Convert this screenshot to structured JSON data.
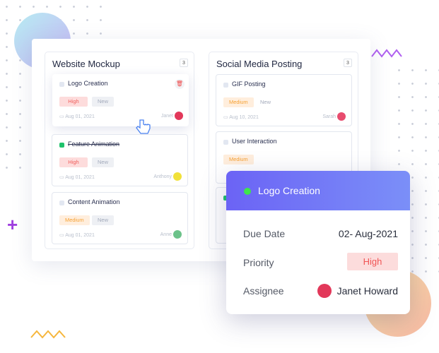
{
  "board": {
    "columns": [
      {
        "title": "Website Mockup",
        "count": "3",
        "cards": [
          {
            "title": "Logo Creation",
            "done": false,
            "priority": "High",
            "status": "New",
            "date": "Aug 01, 2021",
            "assignee": "Janet"
          },
          {
            "title": "Feature Animation",
            "done": true,
            "priority": "High",
            "status": "New",
            "date": "Aug 01, 2021",
            "assignee": "Anthony"
          },
          {
            "title": "Content Animation",
            "done": false,
            "priority": "Medium",
            "status": "New",
            "date": "Aug 01, 2021",
            "assignee": "Anne"
          }
        ]
      },
      {
        "title": "Social Media Posting",
        "count": "3",
        "cards": [
          {
            "title": "GIF Posting",
            "done": false,
            "priority": "Medium",
            "status": "New",
            "date": "Aug 10, 2021",
            "assignee": "Sarah"
          },
          {
            "title": "User Interaction",
            "done": false,
            "priority": "Medium"
          }
        ]
      }
    ]
  },
  "popup": {
    "title": "Logo Creation",
    "status_color": "#3ee64a",
    "due_label": "Due Date",
    "due_value": "02- Aug-2021",
    "priority_label": "Priority",
    "priority_value": "High",
    "assignee_label": "Assignee",
    "assignee_value": "Janet Howard"
  },
  "icons": [
    "trash-icon",
    "calendar-icon",
    "hand-pointer-icon",
    "plus-icon"
  ],
  "colors": {
    "accent": "#6b63f5",
    "high": "#f0605d",
    "medium": "#f6a234",
    "done": "#1ec26b"
  }
}
